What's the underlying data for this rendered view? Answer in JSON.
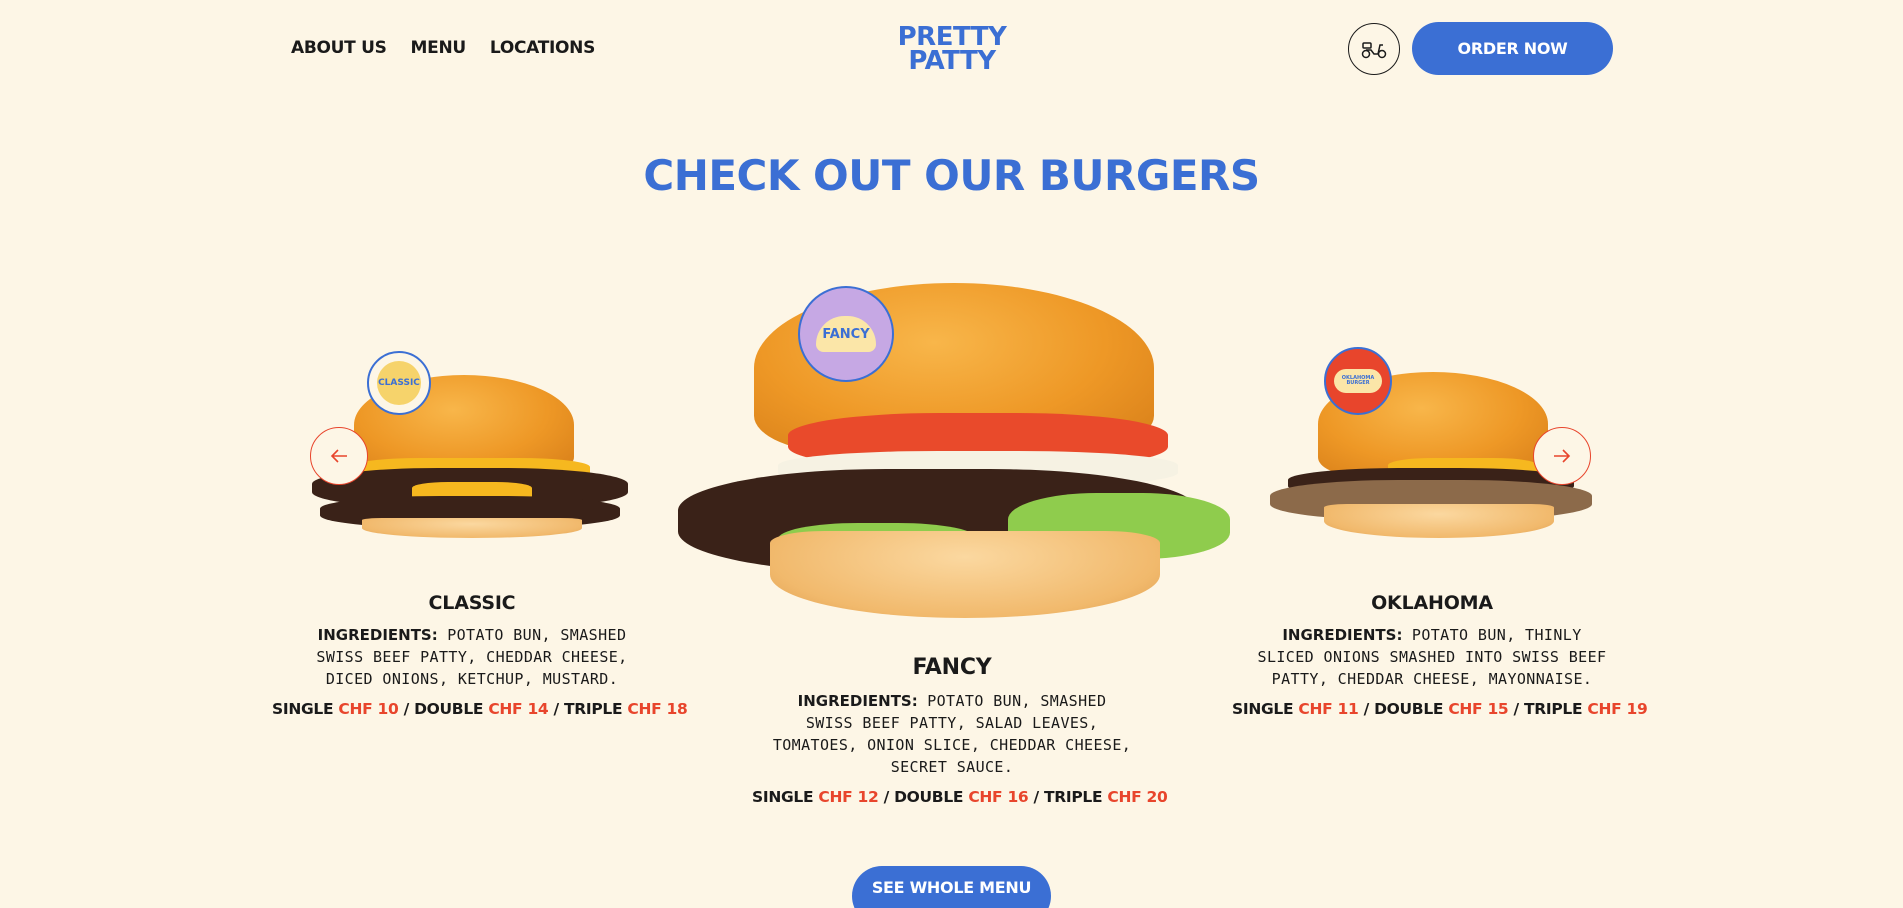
{
  "nav": {
    "links": [
      "ABOUT US",
      "MENU",
      "LOCATIONS"
    ],
    "logo_line1": "PRETTY",
    "logo_line2": "PATTY",
    "order_label": "ORDER NOW",
    "delivery_icon": "scooter-icon"
  },
  "section": {
    "title": "CHECK OUT OUR BURGERS"
  },
  "burgers": [
    {
      "name": "CLASSIC",
      "badge": "CLASSIC",
      "ingredients_label": "INGREDIENTS:",
      "ingredients": "POTATO BUN, SMASHED SWISS BEEF PATTY, CHEDDAR CHEESE, DICED ONIONS, KETCHUP, MUSTARD.",
      "single_label": "SINGLE",
      "single_price": "CHF 10",
      "double_label": "/ DOUBLE",
      "double_price": "CHF 14",
      "triple_label": "/ TRIPLE",
      "triple_price": "CHF 18"
    },
    {
      "name": "FANCY",
      "badge": "FANCY",
      "ingredients_label": "INGREDIENTS:",
      "ingredients": "POTATO BUN, SMASHED SWISS BEEF PATTY, SALAD LEAVES, TOMATOES, ONION SLICE, CHEDDAR CHEESE, SECRET SAUCE.",
      "single_label": "SINGLE",
      "single_price": "CHF 12",
      "double_label": "/ DOUBLE",
      "double_price": "CHF 16",
      "triple_label": "/ TRIPLE",
      "triple_price": "CHF 20"
    },
    {
      "name": "OKLAHOMA",
      "badge": "OKLAHOMA BURGER",
      "ingredients_label": "INGREDIENTS:",
      "ingredients": "POTATO BUN, THINLY SLICED ONIONS SMASHED INTO SWISS BEEF PATTY, CHEDDAR CHEESE, MAYONNAISE.",
      "single_label": "SINGLE",
      "single_price": "CHF 11",
      "double_label": "/ DOUBLE",
      "double_price": "CHF 15",
      "triple_label": "/ TRIPLE",
      "triple_price": "CHF 19"
    }
  ],
  "carousel": {
    "prev_icon": "arrow-left-icon",
    "next_icon": "arrow-right-icon"
  },
  "cta": {
    "menu_label": "SEE WHOLE MENU"
  },
  "colors": {
    "background": "#fdf6e6",
    "brand_blue": "#3b6fd4",
    "price_red": "#e8452c"
  }
}
